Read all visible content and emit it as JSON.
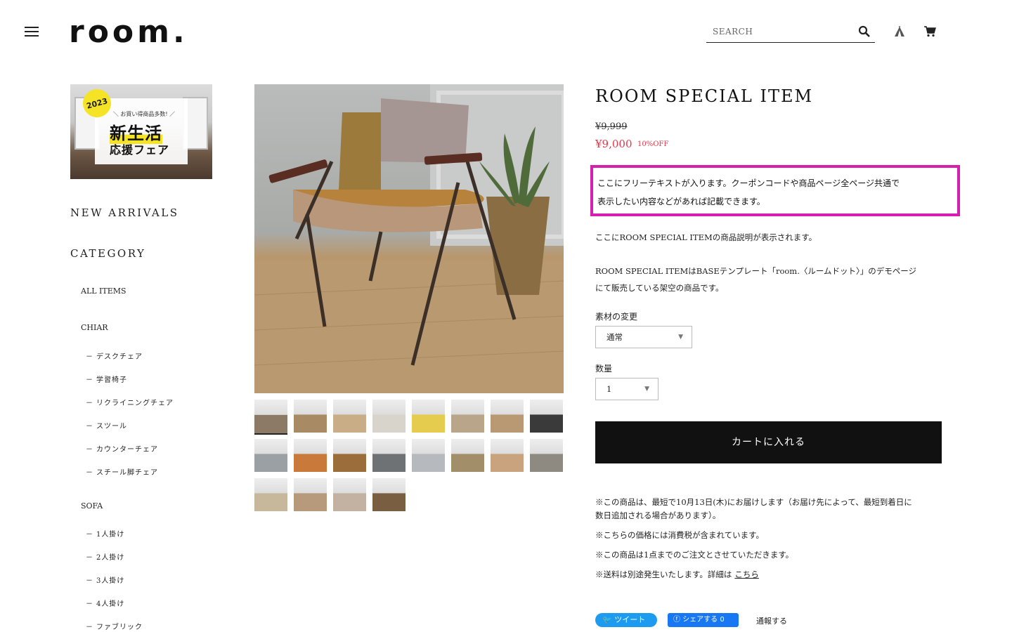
{
  "header": {
    "logo": "room.",
    "search_placeholder": "SEARCH",
    "icons": [
      "menu-icon",
      "search-icon",
      "tent-icon",
      "cart-icon"
    ]
  },
  "banner": {
    "year": "2023",
    "subtitle": "＼ お買い得商品多数! ／",
    "title": "新生活",
    "title2": "応援フェア"
  },
  "sidebar": {
    "new_arrivals": "NEW ARRIVALS",
    "category": "CATEGORY",
    "all_items": "ALL ITEMS",
    "chiar": {
      "label": "CHIAR",
      "items": [
        "デスクチェア",
        "学習椅子",
        "リクライニングチェア",
        "スツール",
        "カウンターチェア",
        "スチール脚チェア"
      ]
    },
    "sofa": {
      "label": "SOFA",
      "items": [
        "1人掛け",
        "2人掛け",
        "3人掛け",
        "4人掛け",
        "ファブリック"
      ]
    }
  },
  "gallery": {
    "thumbnail_count": 20,
    "active_index": 0
  },
  "product": {
    "title": "ROOM SPECIAL ITEM",
    "old_price": "¥9,999",
    "price": "¥9,000",
    "discount": "10%OFF",
    "free_text_line1": "ここにフリーテキストが入ります。クーポンコードや商品ページ全ページ共通で",
    "free_text_line2": "表示したい内容などがあれば記載できます。",
    "desc1": "ここにROOM SPECIAL ITEMの商品説明が表示されます。",
    "desc2_line1": "ROOM SPECIAL ITEMはBASEテンプレート「room.〈ルームドット〉」のデモページ",
    "desc2_line2": "にて販売している架空の商品です。",
    "material_label": "素材の変更",
    "material_value": "通常",
    "quantity_label": "数量",
    "quantity_value": "1",
    "cart_button": "カートに入れる",
    "note1_line1": "※この商品は、最短で10月13日(木)にお届けします（お届け先によって、最短到着日に",
    "note1_line2": "数日追加される場合があります）。",
    "note2": "※こちらの価格には消費税が含まれています。",
    "note3": "※この商品は1点までのご注文とさせていただきます。",
    "note4": "※送料は別途発生いたします。詳細は",
    "note4_link": "こちら",
    "tweet": "ツイート",
    "fb_share": "シェアする 0",
    "report": "通報する"
  },
  "colors": {
    "accent_sale": "#e23a4a",
    "highlight_border": "#d61fb1",
    "cart_button": "#111111",
    "twitter": "#1d9bf0",
    "facebook": "#1877f2"
  }
}
